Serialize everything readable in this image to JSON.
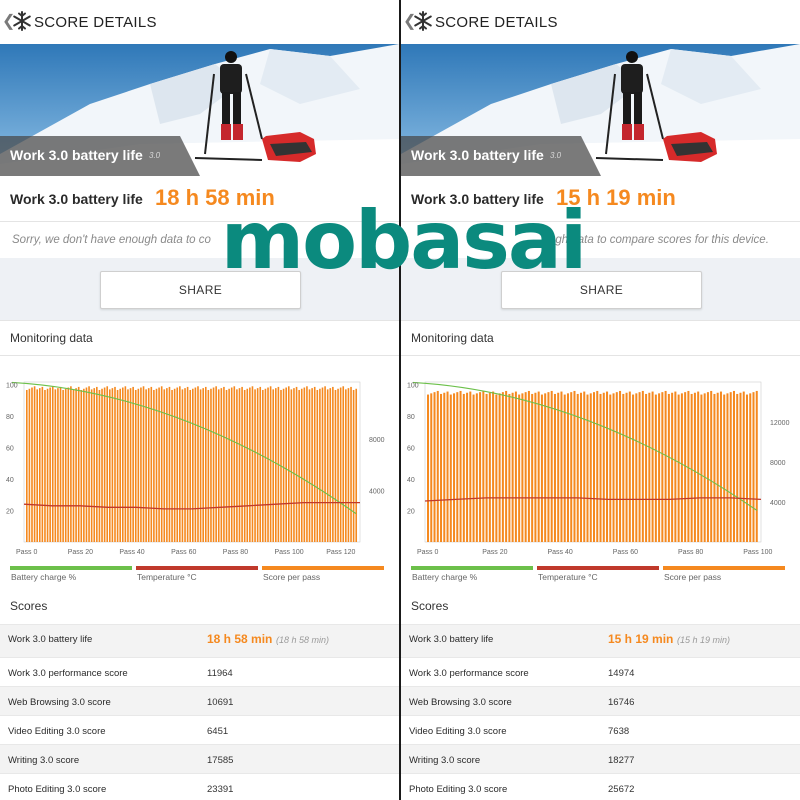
{
  "watermark": "mobasai",
  "colors": {
    "accent": "#f5891f",
    "battery": "#6cc04a",
    "temperature": "#c0392b",
    "score": "#f5891f",
    "watermark": "#0b8a7e"
  },
  "panels": [
    {
      "header": {
        "title": "SCORE DETAILS",
        "back_icon": "chevron-left-icon",
        "app_icon": "snowflake-icon"
      },
      "hero": {
        "label": "Work 3.0 battery life",
        "version": "3.0"
      },
      "result": {
        "label": "Work 3.0 battery life",
        "value": "18 h 58 min"
      },
      "notice": "Sorry, we don't have enough data to co",
      "share_label": "SHARE",
      "monitoring_title": "Monitoring data",
      "chart_data": {
        "type": "bar",
        "title": "",
        "x_ticks": [
          "Pass 0",
          "Pass 20",
          "Pass 40",
          "Pass 60",
          "Pass 80",
          "Pass 100",
          "Pass 120"
        ],
        "x_max": 130,
        "left_axis_ticks": [
          "100",
          "80",
          "60",
          "40",
          "20"
        ],
        "right_axis_ticks": [
          "8000",
          "4000"
        ],
        "series": [
          {
            "name": "Battery charge %",
            "type": "line",
            "start": 100,
            "end": 18
          },
          {
            "name": "Temperature °C",
            "type": "line",
            "values": [
              24,
              23,
              23,
              22,
              22,
              21,
              21,
              22,
              23,
              24,
              25,
              25,
              25
            ]
          },
          {
            "name": "Score per pass",
            "type": "bar",
            "bar_count": 128,
            "typical_value": 11960
          }
        ],
        "right_axis_max": 12400
      },
      "legend": [
        "Battery charge %",
        "Temperature °C",
        "Score per pass"
      ],
      "scores_title": "Scores",
      "scores": [
        {
          "name": "Work 3.0 battery life",
          "value": "18 h 58 min",
          "sub": "(18 h 58 min)"
        },
        {
          "name": "Work 3.0 performance score",
          "value": "11964"
        },
        {
          "name": "Web Browsing 3.0 score",
          "value": "10691"
        },
        {
          "name": "Video Editing 3.0 score",
          "value": "6451"
        },
        {
          "name": "Writing 3.0 score",
          "value": "17585"
        },
        {
          "name": "Photo Editing 3.0 score",
          "value": "23391"
        }
      ]
    },
    {
      "header": {
        "title": "SCORE DETAILS",
        "back_icon": "chevron-left-icon",
        "app_icon": "snowflake-icon"
      },
      "hero": {
        "label": "Work 3.0 battery life",
        "version": "3.0"
      },
      "result": {
        "label": "Work 3.0 battery life",
        "value": "15 h 19 min"
      },
      "notice": "ugh data to compare scores for this device.",
      "share_label": "SHARE",
      "monitoring_title": "Monitoring data",
      "chart_data": {
        "type": "bar",
        "title": "",
        "x_ticks": [
          "Pass 0",
          "Pass 20",
          "Pass 40",
          "Pass 60",
          "Pass 80",
          "Pass 100"
        ],
        "x_max": 103,
        "left_axis_ticks": [
          "100",
          "80",
          "60",
          "40",
          "20"
        ],
        "right_axis_ticks": [
          "12000",
          "8000",
          "4000"
        ],
        "series": [
          {
            "name": "Battery charge %",
            "type": "line",
            "start": 100,
            "end": 20
          },
          {
            "name": "Temperature °C",
            "type": "line",
            "values": [
              26,
              27,
              28,
              28,
              28,
              28,
              27,
              27,
              27,
              28,
              28,
              27
            ]
          },
          {
            "name": "Score per pass",
            "type": "bar",
            "bar_count": 102,
            "typical_value": 14970
          }
        ],
        "right_axis_max": 16000
      },
      "legend": [
        "Battery charge %",
        "Temperature °C",
        "Score per pass"
      ],
      "scores_title": "Scores",
      "scores": [
        {
          "name": "Work 3.0 battery life",
          "value": "15 h 19 min",
          "sub": "(15 h 19 min)"
        },
        {
          "name": "Work 3.0 performance score",
          "value": "14974"
        },
        {
          "name": "Web Browsing 3.0 score",
          "value": "16746"
        },
        {
          "name": "Video Editing 3.0 score",
          "value": "7638"
        },
        {
          "name": "Writing 3.0 score",
          "value": "18277"
        },
        {
          "name": "Photo Editing 3.0 score",
          "value": "25672"
        }
      ]
    }
  ]
}
